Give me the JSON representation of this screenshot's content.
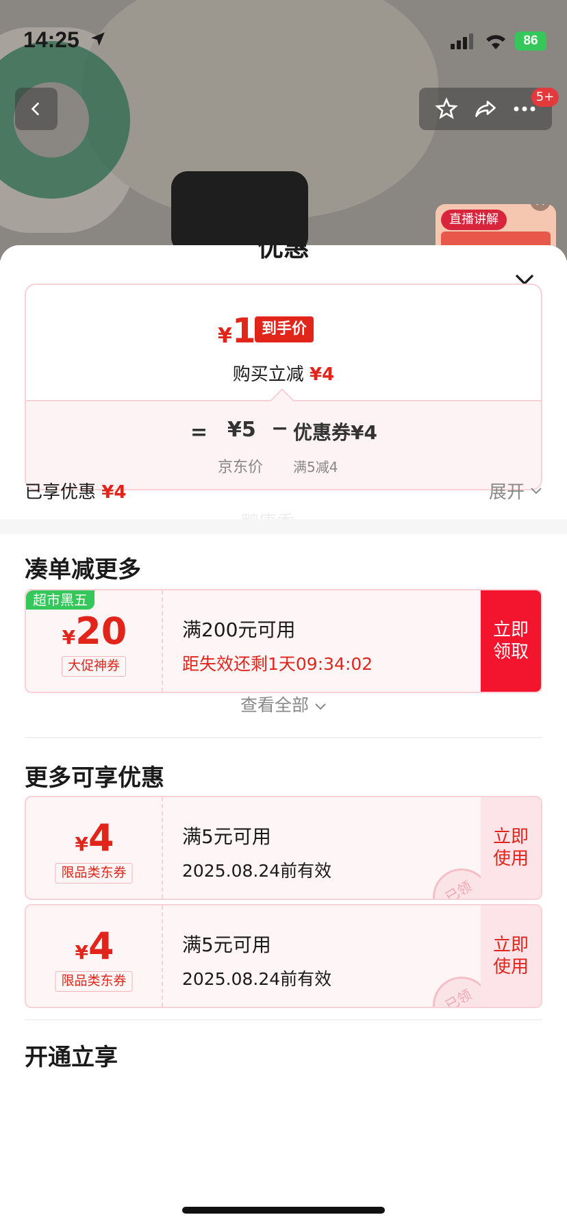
{
  "status_bar": {
    "time": "14:25",
    "battery": "86"
  },
  "header": {
    "cart_badge": "5+",
    "live_tag": "直播讲解"
  },
  "sheet": {
    "title": "优惠",
    "summary": {
      "currency": "¥",
      "final_price": "1",
      "final_tag": "到手价",
      "instant_text": "购买立减",
      "instant_amount": "¥4",
      "eq": "=",
      "jd_price": "¥5",
      "minus": "−",
      "coupon_text": "优惠券¥4",
      "jd_label": "京东价",
      "coupon_rule": "满5减4"
    },
    "enjoyed_label": "已享优惠",
    "enjoyed_amount": "¥4",
    "expand_label": "展开",
    "watermark": "鸭康香"
  },
  "section_more": {
    "title": "凑单减更多",
    "coupon": {
      "tag": "超市黑五",
      "currency": "¥",
      "amount": "20",
      "type": "大促神券",
      "condition": "满200元可用",
      "countdown": "距失效还剩1天09:34:02",
      "button": "立即领取"
    },
    "view_all": "查看全部"
  },
  "section_available": {
    "title": "更多可享优惠",
    "coupons": [
      {
        "currency": "¥",
        "amount": "4",
        "type": "限品类东券",
        "condition": "满5元可用",
        "valid": "2025.08.24前有效",
        "button": "立即使用",
        "stamp": "已领"
      },
      {
        "currency": "¥",
        "amount": "4",
        "type": "限品类东券",
        "condition": "满5元可用",
        "valid": "2025.08.24前有效",
        "button": "立即使用",
        "stamp": "已领"
      }
    ]
  },
  "section_open": {
    "title": "开通立享"
  }
}
